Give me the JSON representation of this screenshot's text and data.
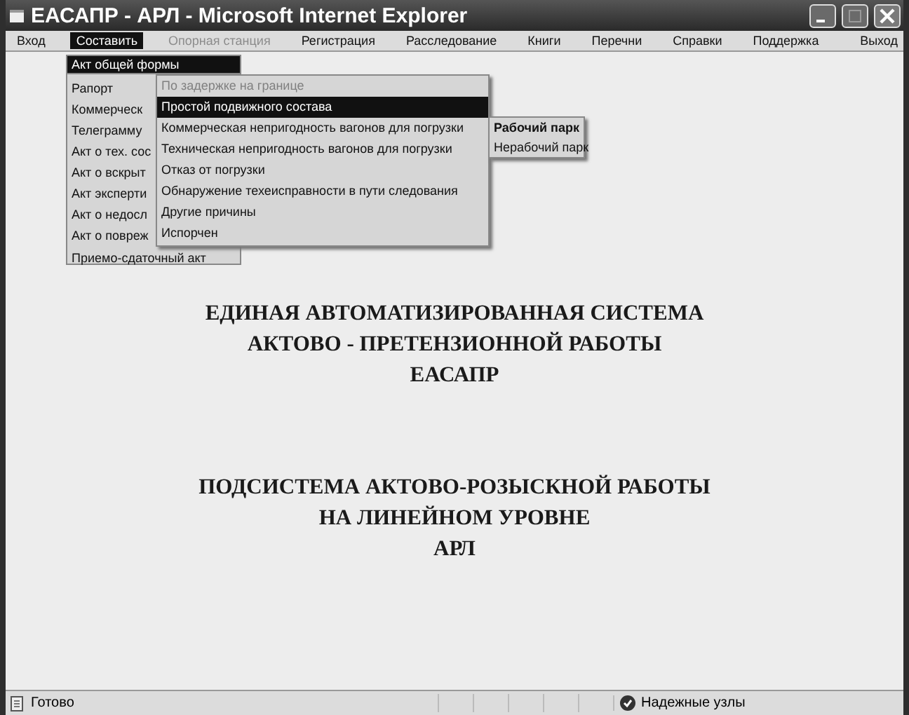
{
  "window": {
    "title": "ЕАСАПР - АРЛ - Microsoft Internet Explorer"
  },
  "menubar": {
    "items": [
      {
        "label": "Вход",
        "selected": false,
        "disabled": false
      },
      {
        "label": "Составить",
        "selected": true,
        "disabled": false
      },
      {
        "label": "Опорная станция",
        "selected": false,
        "disabled": true
      },
      {
        "label": "Регистрация",
        "selected": false,
        "disabled": false
      },
      {
        "label": "Расследование",
        "selected": false,
        "disabled": false
      },
      {
        "label": "Книги",
        "selected": false,
        "disabled": false
      },
      {
        "label": "Перечни",
        "selected": false,
        "disabled": false
      },
      {
        "label": "Справки",
        "selected": false,
        "disabled": false
      },
      {
        "label": "Поддержка",
        "selected": false,
        "disabled": false
      }
    ],
    "exit": "Выход"
  },
  "menu": {
    "first": {
      "label": "Акт общей формы",
      "selected": true
    },
    "items": [
      {
        "label": "Рапорт",
        "selected": false
      },
      {
        "label": "Коммерческ",
        "selected": false
      },
      {
        "label": "Телеграмму",
        "selected": false
      },
      {
        "label": "Акт о тех. сос",
        "selected": false
      },
      {
        "label": "Акт о вскрыт",
        "selected": false
      },
      {
        "label": "Акт эксперти",
        "selected": false
      },
      {
        "label": "Акт о недосл",
        "selected": false
      },
      {
        "label": "Акт о повреж",
        "selected": false
      }
    ],
    "last": {
      "label": "Приемо-сдаточный акт",
      "selected": false
    }
  },
  "submenu": {
    "items": [
      {
        "label": "По задержке на границе",
        "selected": false,
        "disabled": true
      },
      {
        "label": "Простой подвижного состава",
        "selected": true,
        "disabled": false
      },
      {
        "label": "Коммерческая непригодность вагонов для погрузки",
        "selected": false,
        "disabled": false
      },
      {
        "label": "Техническая непригодность вагонов для погрузки",
        "selected": false,
        "disabled": false
      },
      {
        "label": "Отказ от погрузки",
        "selected": false,
        "disabled": false
      },
      {
        "label": "Обнаружение техеисправности в пути следования",
        "selected": false,
        "disabled": false
      },
      {
        "label": "Другие причины",
        "selected": false,
        "disabled": false
      },
      {
        "label": "Испорчен",
        "selected": false,
        "disabled": false
      }
    ]
  },
  "subsubmenu": {
    "items": [
      {
        "label": "Рабочий парк",
        "selected": true
      },
      {
        "label": "Нерабочий парк",
        "selected": false
      }
    ]
  },
  "headings": [
    [
      "ЕДИНАЯ АВТОМАТИЗИРОВАННАЯ СИСТЕМА",
      "АКТОВО - ПРЕТЕНЗИОННОЙ РАБОТЫ",
      "ЕАСАПР"
    ],
    [
      "ПОДСИСТЕМА АКТОВО-РОЗЫСКНОЙ РАБОТЫ",
      "НА ЛИНЕЙНОМ УРОВНЕ",
      "АРЛ"
    ]
  ],
  "status_bar": {
    "text": "Готово",
    "zone": "Надежные узлы"
  }
}
